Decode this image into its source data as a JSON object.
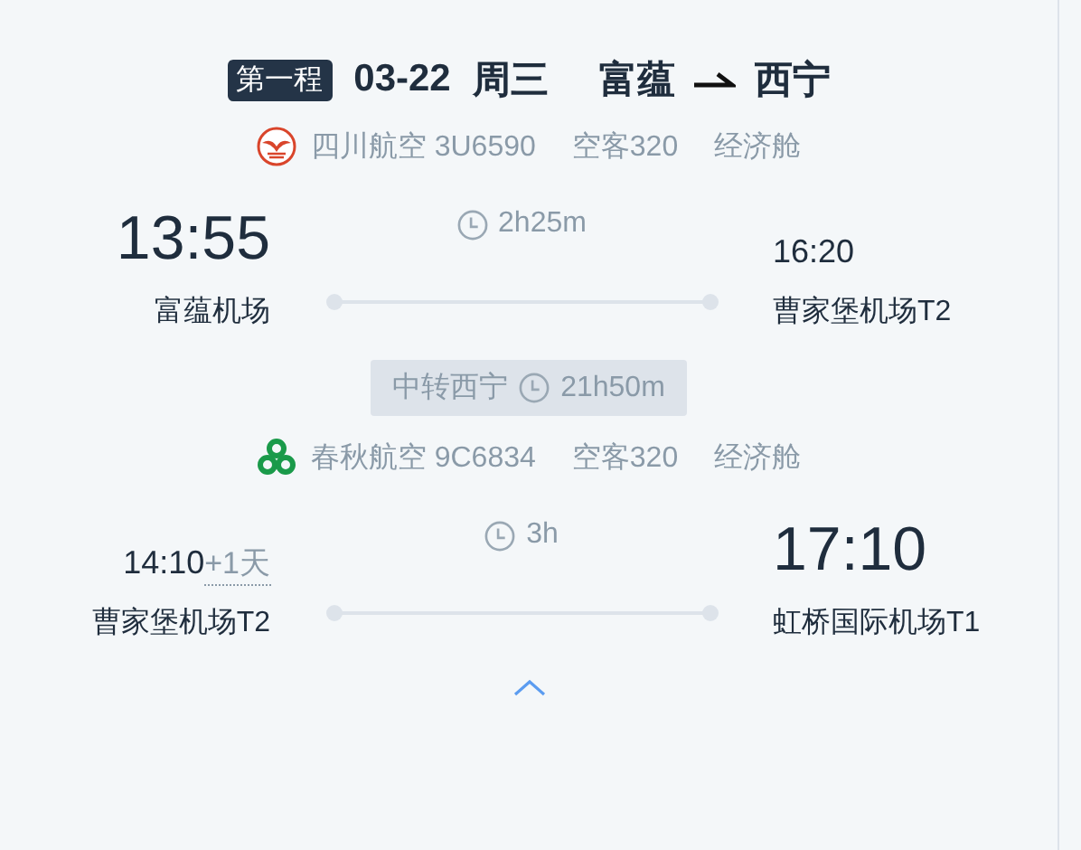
{
  "header": {
    "badge": "第一程",
    "date": "03-22",
    "weekday": "周三",
    "from": "富蕴",
    "to": "西宁"
  },
  "segments": [
    {
      "airline": {
        "kind": "sichuan",
        "name": "四川航空 3U6590",
        "aircraft": "空客320",
        "cabin": "经济舱"
      },
      "depart": {
        "time": "13:55",
        "major": true,
        "airport": "富蕴机场"
      },
      "duration": "2h25m",
      "arrive": {
        "time": "16:20",
        "major": false,
        "airport": "曹家堡机场T2"
      }
    },
    {
      "airline": {
        "kind": "spring",
        "name": "春秋航空 9C6834",
        "aircraft": "空客320",
        "cabin": "经济舱"
      },
      "depart": {
        "time": "14:10",
        "day_offset": "+1天",
        "major": false,
        "airport": "曹家堡机场T2"
      },
      "duration": "3h",
      "arrive": {
        "time": "17:10",
        "major": true,
        "airport": "虹桥国际机场T1"
      }
    }
  ],
  "transfer": {
    "label": "中转西宁",
    "duration": "21h50m"
  }
}
